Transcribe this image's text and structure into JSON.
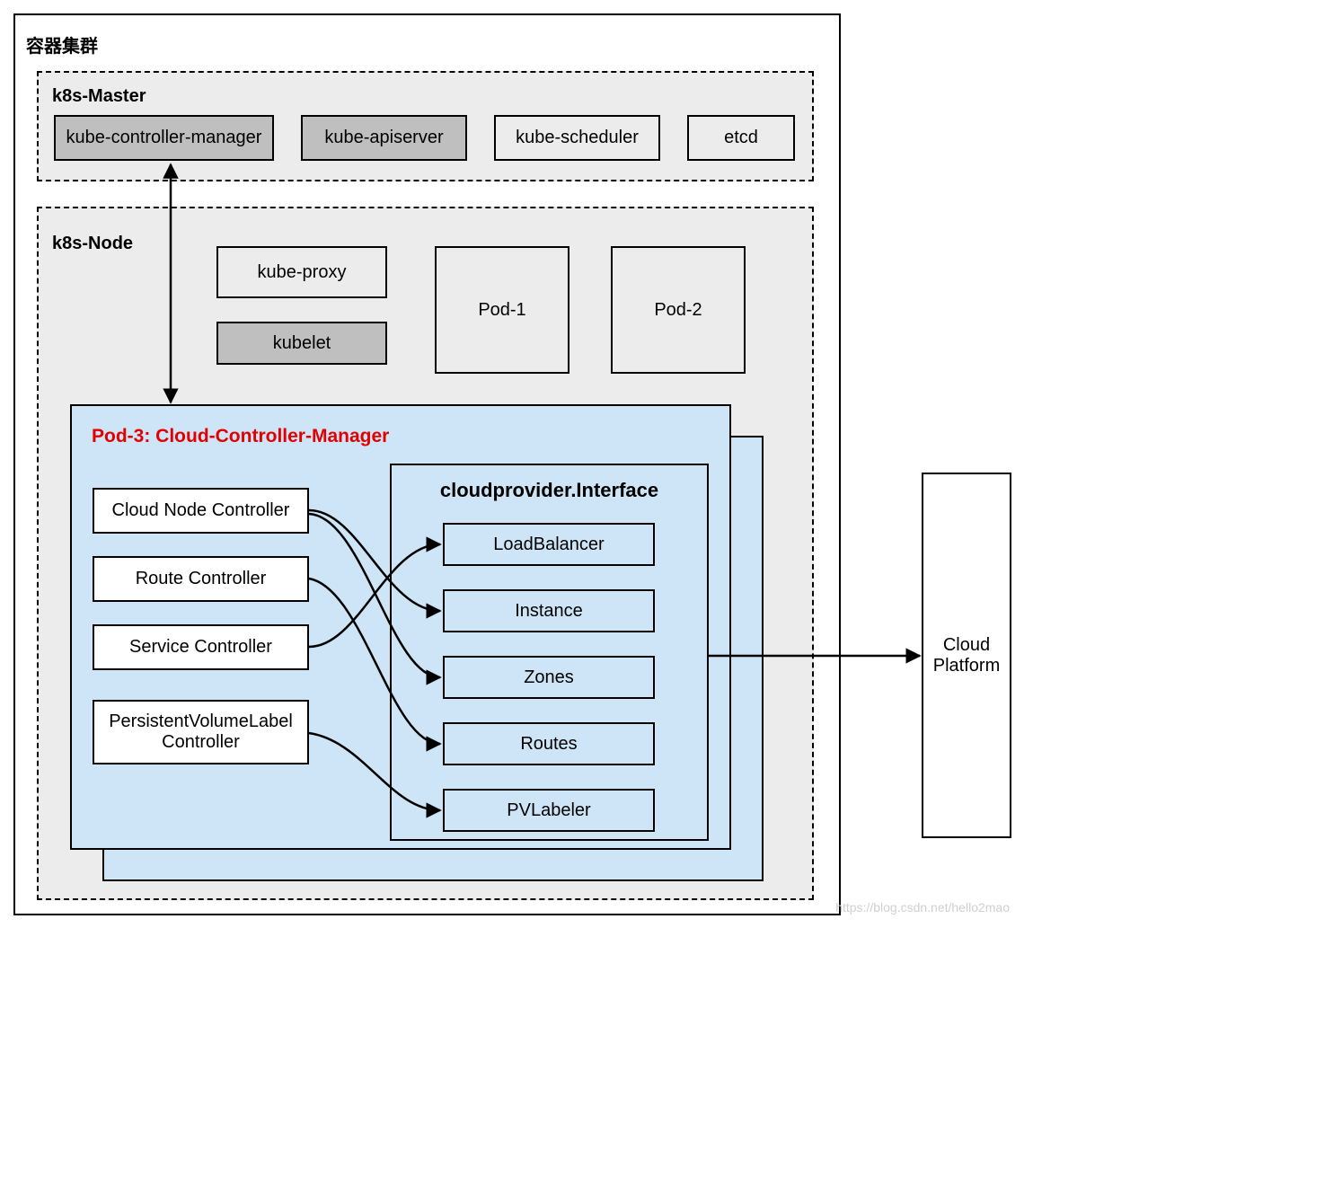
{
  "cluster": {
    "title": "容器集群"
  },
  "master": {
    "title": "k8s-Master",
    "kcm": "kube-controller-manager",
    "kapi": "kube-apiserver",
    "ksched": "kube-scheduler",
    "etcd": "etcd"
  },
  "node": {
    "title": "k8s-Node",
    "kubeproxy": "kube-proxy",
    "kubelet": "kubelet",
    "pod1": "Pod-1",
    "pod2": "Pod-2"
  },
  "ccm": {
    "title": "Pod-3: Cloud-Controller-Manager",
    "controllers": {
      "cloudnode": "Cloud Node Controller",
      "route": "Route Controller",
      "service": "Service Controller",
      "pvlabel": "PersistentVolumeLabel Controller"
    },
    "interface": {
      "title": "cloudprovider.Interface",
      "loadbalancer": "LoadBalancer",
      "instance": "Instance",
      "zones": "Zones",
      "routes": "Routes",
      "pvlabeler": "PVLabeler"
    }
  },
  "cloud": {
    "label": "Cloud Platform"
  },
  "watermark": "https://blog.csdn.net/hello2mao"
}
